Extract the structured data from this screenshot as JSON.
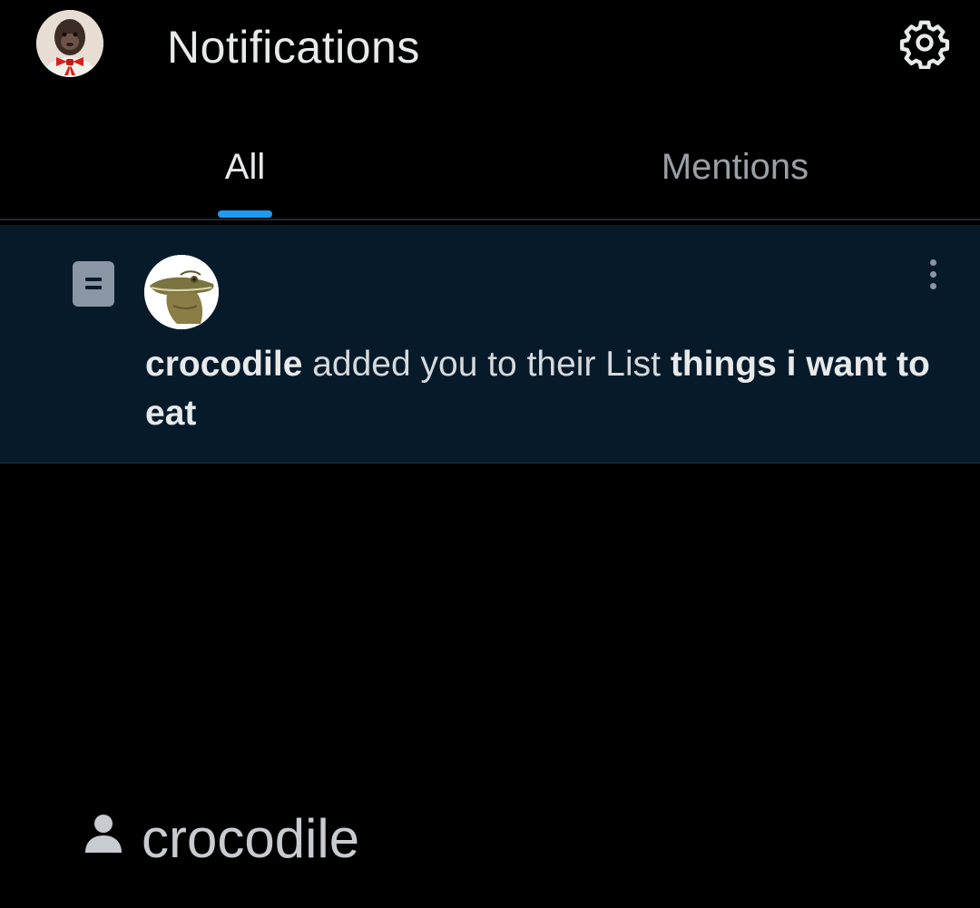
{
  "header": {
    "title": "Notifications",
    "avatar_icon": "monkey-avatar",
    "settings_icon": "gear-icon"
  },
  "tabs": [
    {
      "label": "All",
      "selected": true
    },
    {
      "label": "Mentions",
      "selected": false
    }
  ],
  "notification": {
    "type_icon": "list-icon",
    "actor_avatar": "crocodile-avatar",
    "actor": "crocodile",
    "action": " added you to their List ",
    "list_name": "things i want to eat",
    "more_icon": "more-vertical-icon"
  },
  "footer": {
    "icon": "person-icon",
    "label": "crocodile"
  },
  "colors": {
    "background": "#000000",
    "accent": "#1d9bf0",
    "notification_bg": "#071a2a",
    "text_primary": "#e7e9ea",
    "text_secondary": "#9aa0a6"
  }
}
